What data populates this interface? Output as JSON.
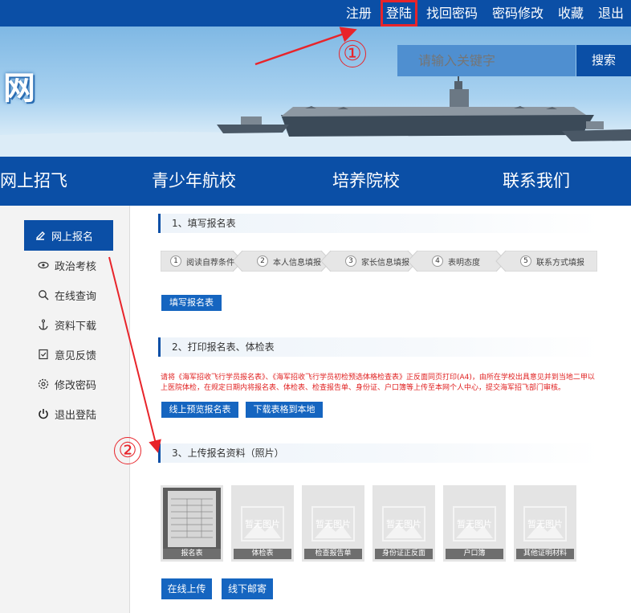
{
  "top_links": [
    "注册",
    "登陆",
    "找回密码",
    "密码修改",
    "收藏",
    "退出"
  ],
  "banner": {
    "logo_text": "网",
    "search_placeholder": "请输入关键字",
    "search_button": "搜索"
  },
  "nav": [
    "网上招飞",
    "青少年航校",
    "培养院校",
    "联系我们"
  ],
  "sidebar": [
    {
      "label": "网上报名",
      "icon": "pen-icon"
    },
    {
      "label": "政治考核",
      "icon": "eye-icon"
    },
    {
      "label": "在线查询",
      "icon": "search-icon"
    },
    {
      "label": "资料下载",
      "icon": "anchor-icon"
    },
    {
      "label": "意见反馈",
      "icon": "feedback-icon"
    },
    {
      "label": "修改密码",
      "icon": "gear-icon"
    },
    {
      "label": "退出登陆",
      "icon": "power-icon"
    }
  ],
  "section1": {
    "title": "1、填写报名表",
    "steps": [
      {
        "num": "1",
        "label": "阅读自荐条件"
      },
      {
        "num": "2",
        "label": "本人信息填报"
      },
      {
        "num": "3",
        "label": "家长信息填报"
      },
      {
        "num": "4",
        "label": "表明态度"
      },
      {
        "num": "5",
        "label": "联系方式填报"
      }
    ],
    "button": "填写报名表"
  },
  "section2": {
    "title": "2、打印报名表、体检表",
    "notice": "请将《海军招收飞行学员报名表》、《海军招收飞行学员初检预选体格检查表》正反面同页打印(A4)，由所在学校出具意见并到当地二甲以上医院体检，在规定日期内将报名表、体检表、检查报告单、身份证、户口簿等上传至本网个人中心，提交海军招飞部门审核。",
    "btn_preview": "线上预览报名表",
    "btn_download": "下载表格到本地"
  },
  "section3": {
    "title": "3、上传报名资料（照片）",
    "photos": [
      {
        "label": "报名表"
      },
      {
        "label": "体检表",
        "placeholder": "暂无图片"
      },
      {
        "label": "检查报告单",
        "placeholder": "暂无图片"
      },
      {
        "label": "身份证正反面",
        "placeholder": "暂无图片"
      },
      {
        "label": "户口簿",
        "placeholder": "暂无图片"
      },
      {
        "label": "其他证明材料",
        "placeholder": "暂无图片"
      }
    ],
    "btn_upload": "在线上传",
    "btn_mail": "线下邮寄"
  },
  "annotations": [
    "①",
    "②"
  ],
  "colors": {
    "primary": "#0b4fa6",
    "button": "#1565c0",
    "highlight": "#e8242a",
    "notice": "#e02020"
  }
}
